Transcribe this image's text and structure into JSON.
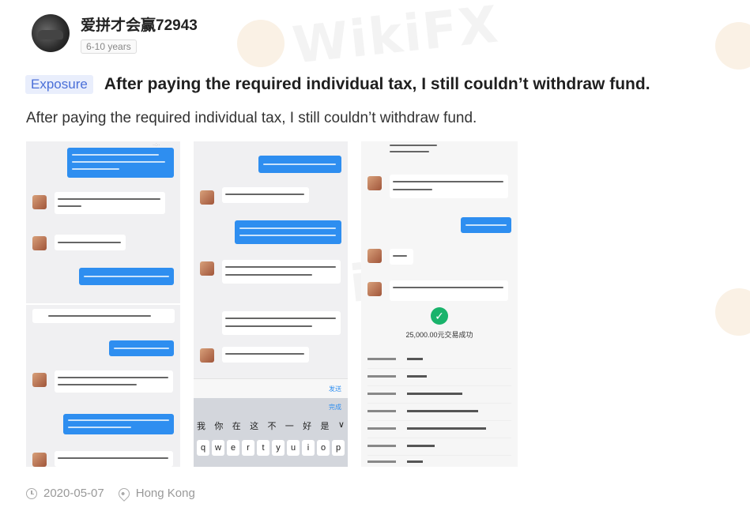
{
  "watermark": {
    "text": "WikiFX"
  },
  "author": {
    "name": "爱拼才会赢72943",
    "experience": "6-10 years",
    "avatar_icon": "car-avatar"
  },
  "post": {
    "tag": "Exposure",
    "title": "After paying the required individual tax, I still couldn’t withdraw fund.",
    "body": "After paying the required individual tax, I still couldn’t withdraw fund."
  },
  "screenshots": {
    "amount": "25,000.00元交易成功",
    "keyboard_cn": [
      "我",
      "你",
      "在",
      "这",
      "不",
      "一",
      "好",
      "是",
      "∨"
    ],
    "keyboard_en": [
      "q",
      "w",
      "e",
      "r",
      "t",
      "y",
      "u",
      "i",
      "o",
      "p"
    ],
    "send_label": "发送",
    "done_label": "完成"
  },
  "footer": {
    "date": "2020-05-07",
    "location": "Hong Kong"
  },
  "colors": {
    "tag_text": "#4a6fd8",
    "tag_bg": "#e9eefc",
    "bubble": "#2e8ef0",
    "success": "#19b36b"
  }
}
